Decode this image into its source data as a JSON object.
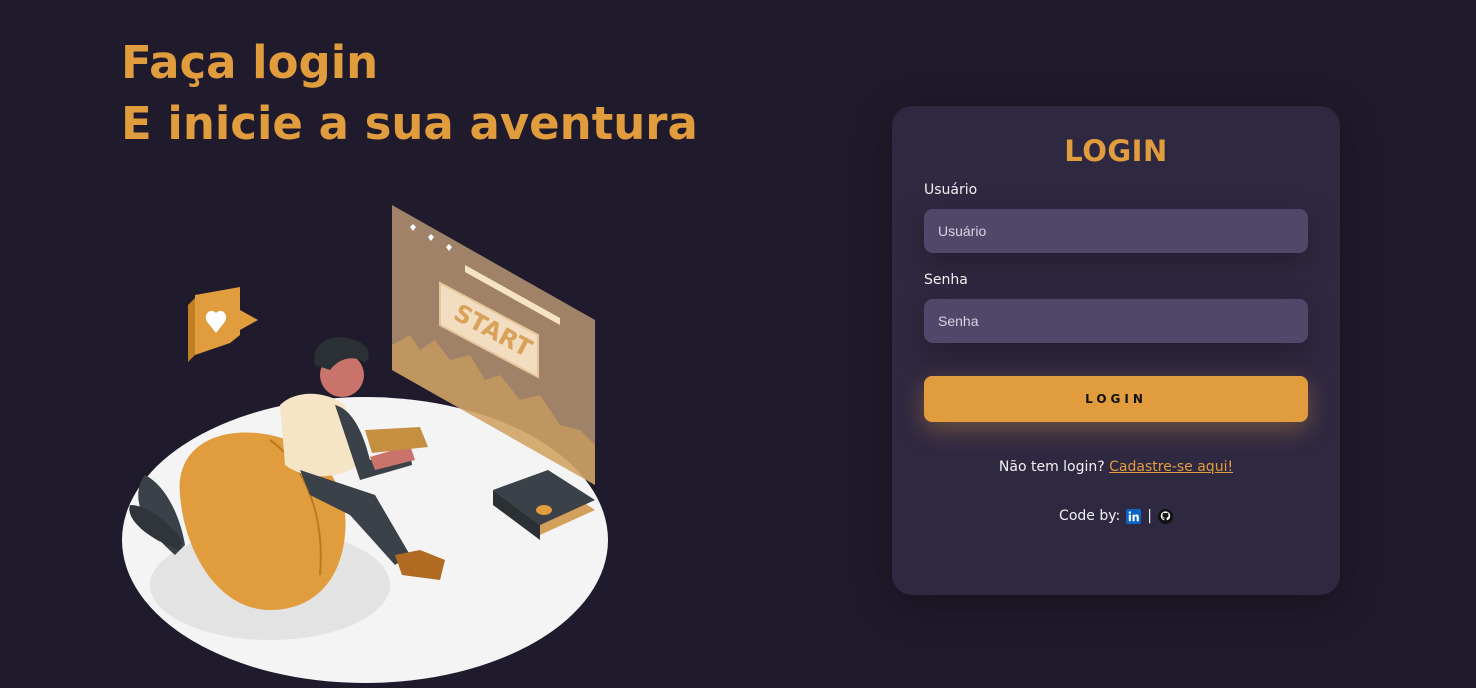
{
  "hero": {
    "line1": "Faça login",
    "line2": "E inicie a sua aventura",
    "illustration": {
      "screen_text": "START",
      "icon": "gamer-on-beanbag-illustration"
    }
  },
  "login": {
    "title": "LOGIN",
    "username_label": "Usuário",
    "username_placeholder": "Usuário",
    "username_value": "",
    "password_label": "Senha",
    "password_placeholder": "Senha",
    "password_value": "",
    "submit_label": "LOGIN",
    "signup_prompt": "Não tem login?",
    "signup_link": "Cadastre-se aqui!",
    "credits_label": "Code by:",
    "credits_separator": "|",
    "credits_icons": [
      "linkedin-icon",
      "github-icon"
    ]
  },
  "colors": {
    "background": "#201b2c",
    "card": "#2f2841",
    "input": "#514869",
    "accent": "#e09c3d",
    "text": "#f1f1f1",
    "linkedin": "#0a66c2"
  }
}
